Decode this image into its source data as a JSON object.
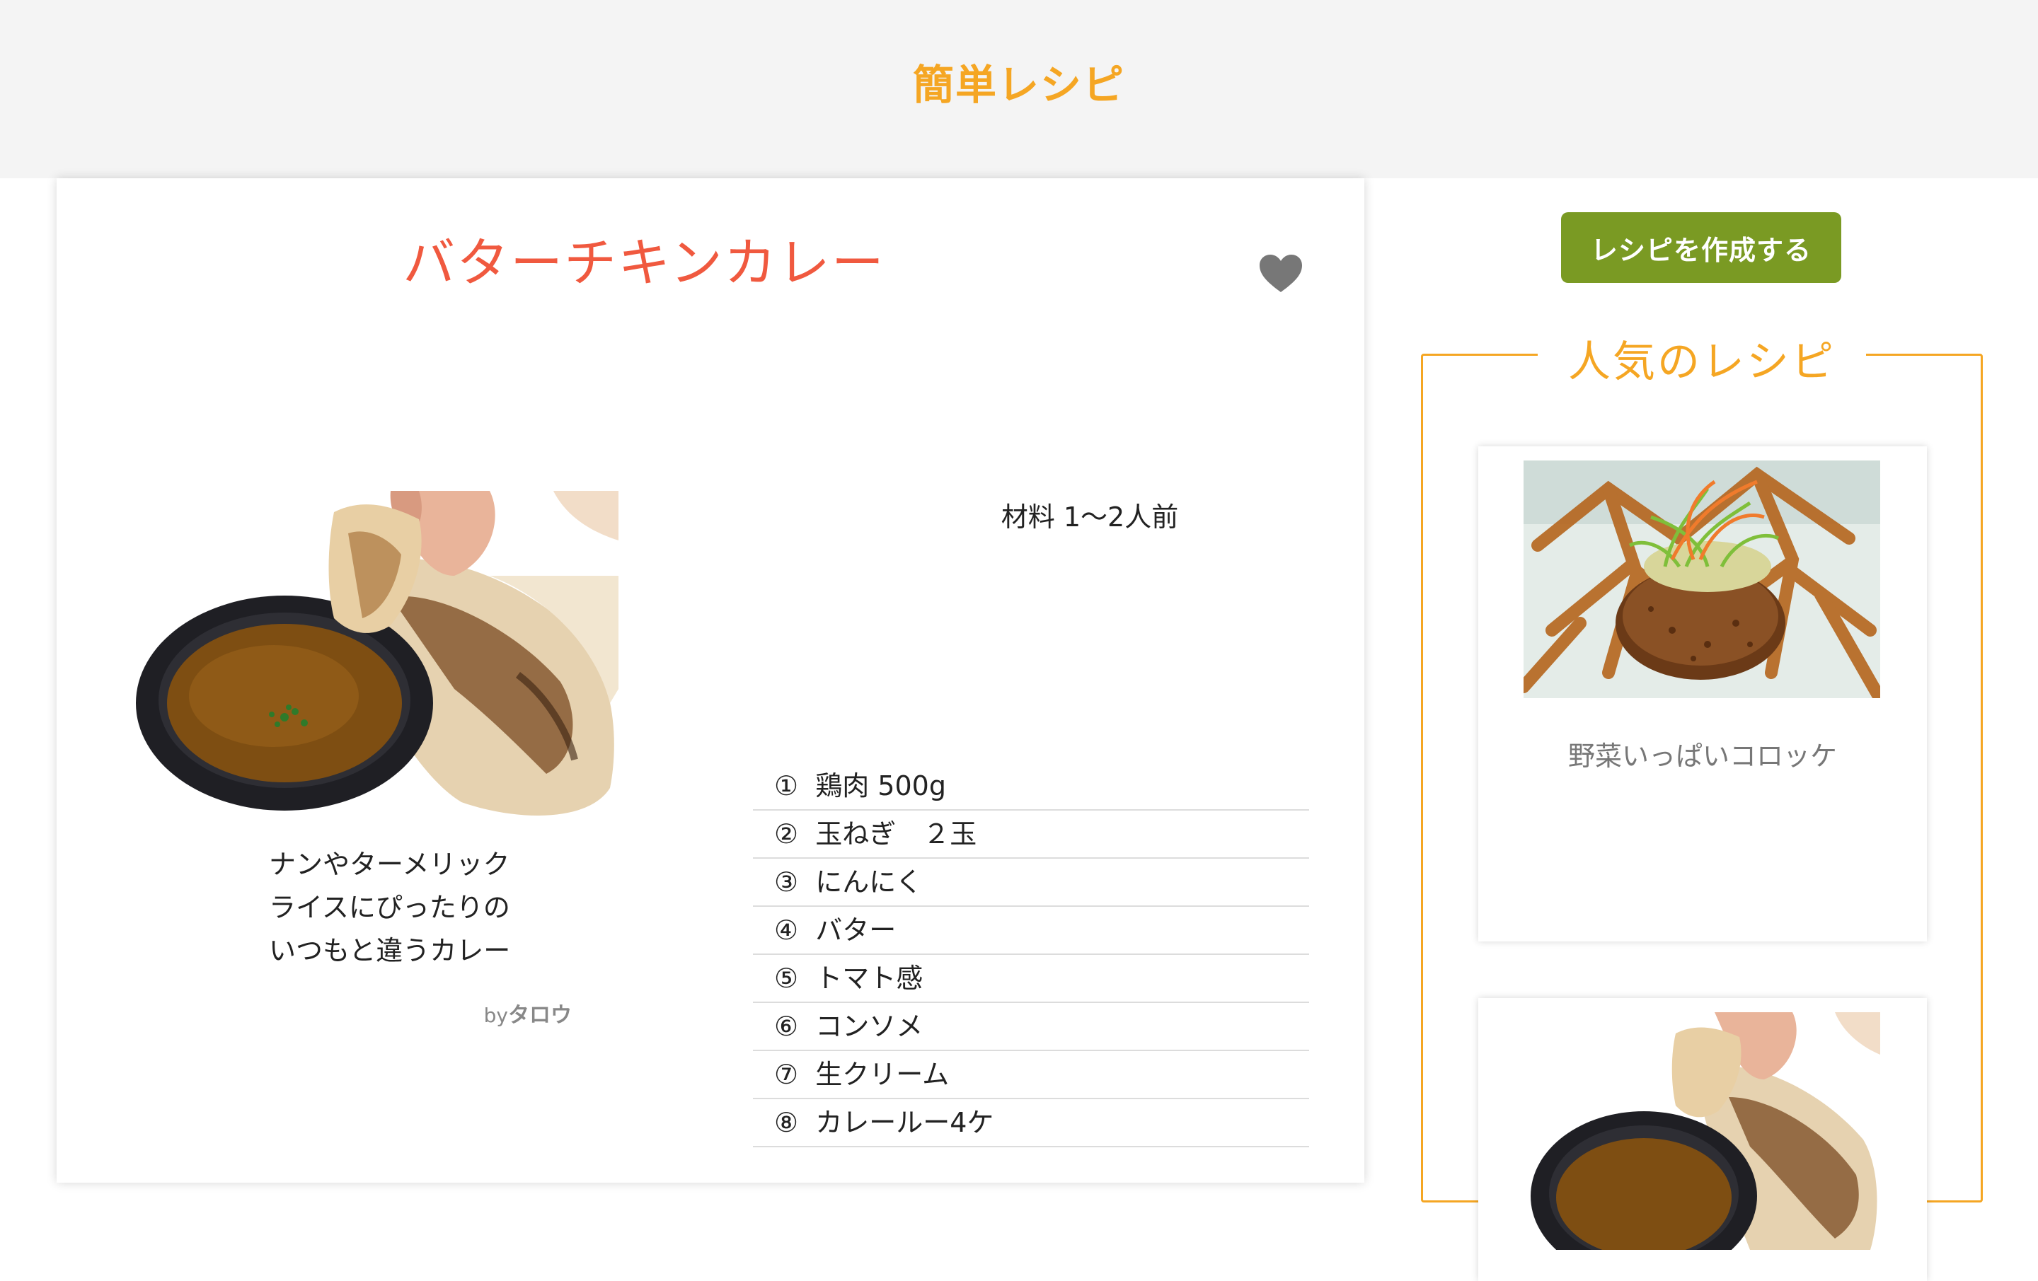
{
  "site": {
    "title": "簡単レシピ"
  },
  "recipe": {
    "title": "バターチキンカレー",
    "description_lines": [
      "ナンやターメリック",
      "ライスにぴったりの",
      "いつもと違うカレー"
    ],
    "author_prefix": "by",
    "author_name": "タロウ",
    "ingredients_heading": "材料 1〜2人前",
    "ingredients": [
      "①  鶏肉 500g",
      "②  玉ねぎ　２玉",
      "③  にんにく",
      "④  バター",
      "⑤  トマト感",
      "⑥  コンソメ",
      "⑦  生クリーム",
      "⑧  カレールー4ケ"
    ],
    "favorite_icon": "heart-icon"
  },
  "sidebar": {
    "create_button": "レシピを作成する",
    "popular_heading": "人気のレシピ",
    "popular": [
      {
        "name": "野菜いっぱいコロッケ"
      },
      {
        "name": ""
      }
    ]
  },
  "colors": {
    "brand_orange": "#f5a623",
    "title_red": "#f0593f",
    "button_green": "#7a9a23",
    "heart_gray": "#777777"
  }
}
